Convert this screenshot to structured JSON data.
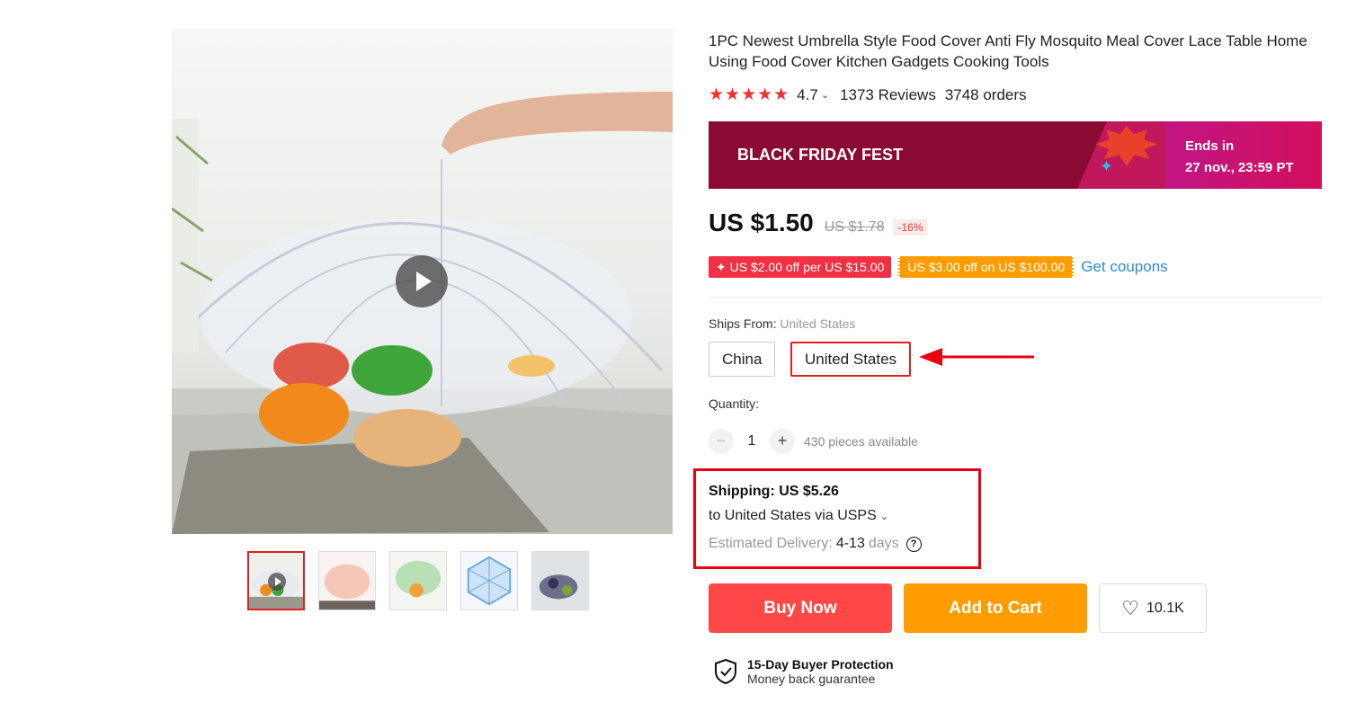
{
  "gallery": {
    "main_image_alt": "umbrella food cover over bowls of food",
    "play_icon": "play-icon",
    "thumbnails": [
      {
        "name": "thumb-1",
        "active": true
      },
      {
        "name": "thumb-2",
        "active": false
      },
      {
        "name": "thumb-3",
        "active": false
      },
      {
        "name": "thumb-4",
        "active": false
      },
      {
        "name": "thumb-5",
        "active": false
      }
    ]
  },
  "product": {
    "title": "1PC Newest Umbrella Style Food Cover Anti Fly Mosquito Meal Cover Lace Table Home Using Food Cover Kitchen Gadgets Cooking Tools",
    "stars": "★★★★★",
    "rating": "4.7",
    "rating_chevron": "⌄",
    "reviews": "1373 Reviews",
    "orders": "3748 orders"
  },
  "banner": {
    "label": "BLACK FRIDAY FEST",
    "ends_in_label": "Ends in",
    "ends_in_time": "27 nov., 23:59 PT",
    "sparkle": "✦"
  },
  "price": {
    "current": "US $1.50",
    "original": "US $1.78",
    "discount": "-16%"
  },
  "coupons": {
    "coupon_1": "✦ US $2.00 off per US $15.00",
    "coupon_2": "US $3.00 off on US $100.00",
    "get_coupons": "Get coupons"
  },
  "ships_from": {
    "label": "Ships From:",
    "selected": "United States",
    "options": [
      "China",
      "United States"
    ]
  },
  "quantity": {
    "label": "Quantity:",
    "minus": "−",
    "value": "1",
    "plus": "+",
    "available": "430 pieces available"
  },
  "shipping": {
    "title": "Shipping: US $5.26",
    "destination": "to United States via USPS",
    "chevron": "⌄",
    "estimated_label": "Estimated Delivery:",
    "estimated_days": "4-13",
    "days_word": "days",
    "help": "?"
  },
  "actions": {
    "buy_now": "Buy Now",
    "add_to_cart": "Add to Cart",
    "wishlist_count": "10.1K",
    "heart": "♡"
  },
  "protection": {
    "title": "15-Day Buyer Protection",
    "subtitle": "Money back guarantee"
  },
  "colors": {
    "accent_red": "#ff4747",
    "accent_orange": "#ff9c00",
    "link_blue": "#2e8bd0",
    "highlight_box": "#e8000f",
    "banner_bg": "#8b0a33"
  }
}
